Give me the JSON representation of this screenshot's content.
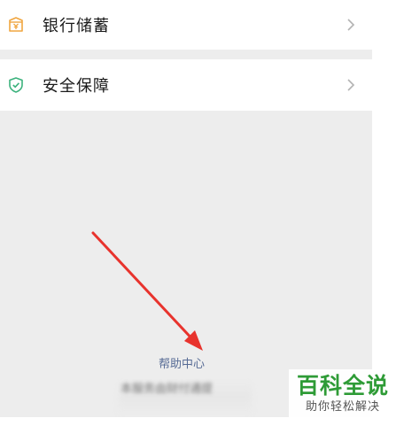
{
  "settings": {
    "items": [
      {
        "label": "银行储蓄",
        "icon": "bank-vault-icon",
        "icon_color": "#f0a640"
      },
      {
        "label": "安全保障",
        "icon": "shield-check-icon",
        "icon_color": "#3cb27d"
      }
    ]
  },
  "footer": {
    "help_link": "帮助中心",
    "provider_text": "本服务由财付通提"
  },
  "watermark": {
    "title": "百科全说",
    "subtitle": "助你轻松解决"
  },
  "colors": {
    "background": "#ededed",
    "link": "#576b95",
    "annotation_arrow": "#e8332d",
    "watermark_green": "#2e9b36"
  }
}
